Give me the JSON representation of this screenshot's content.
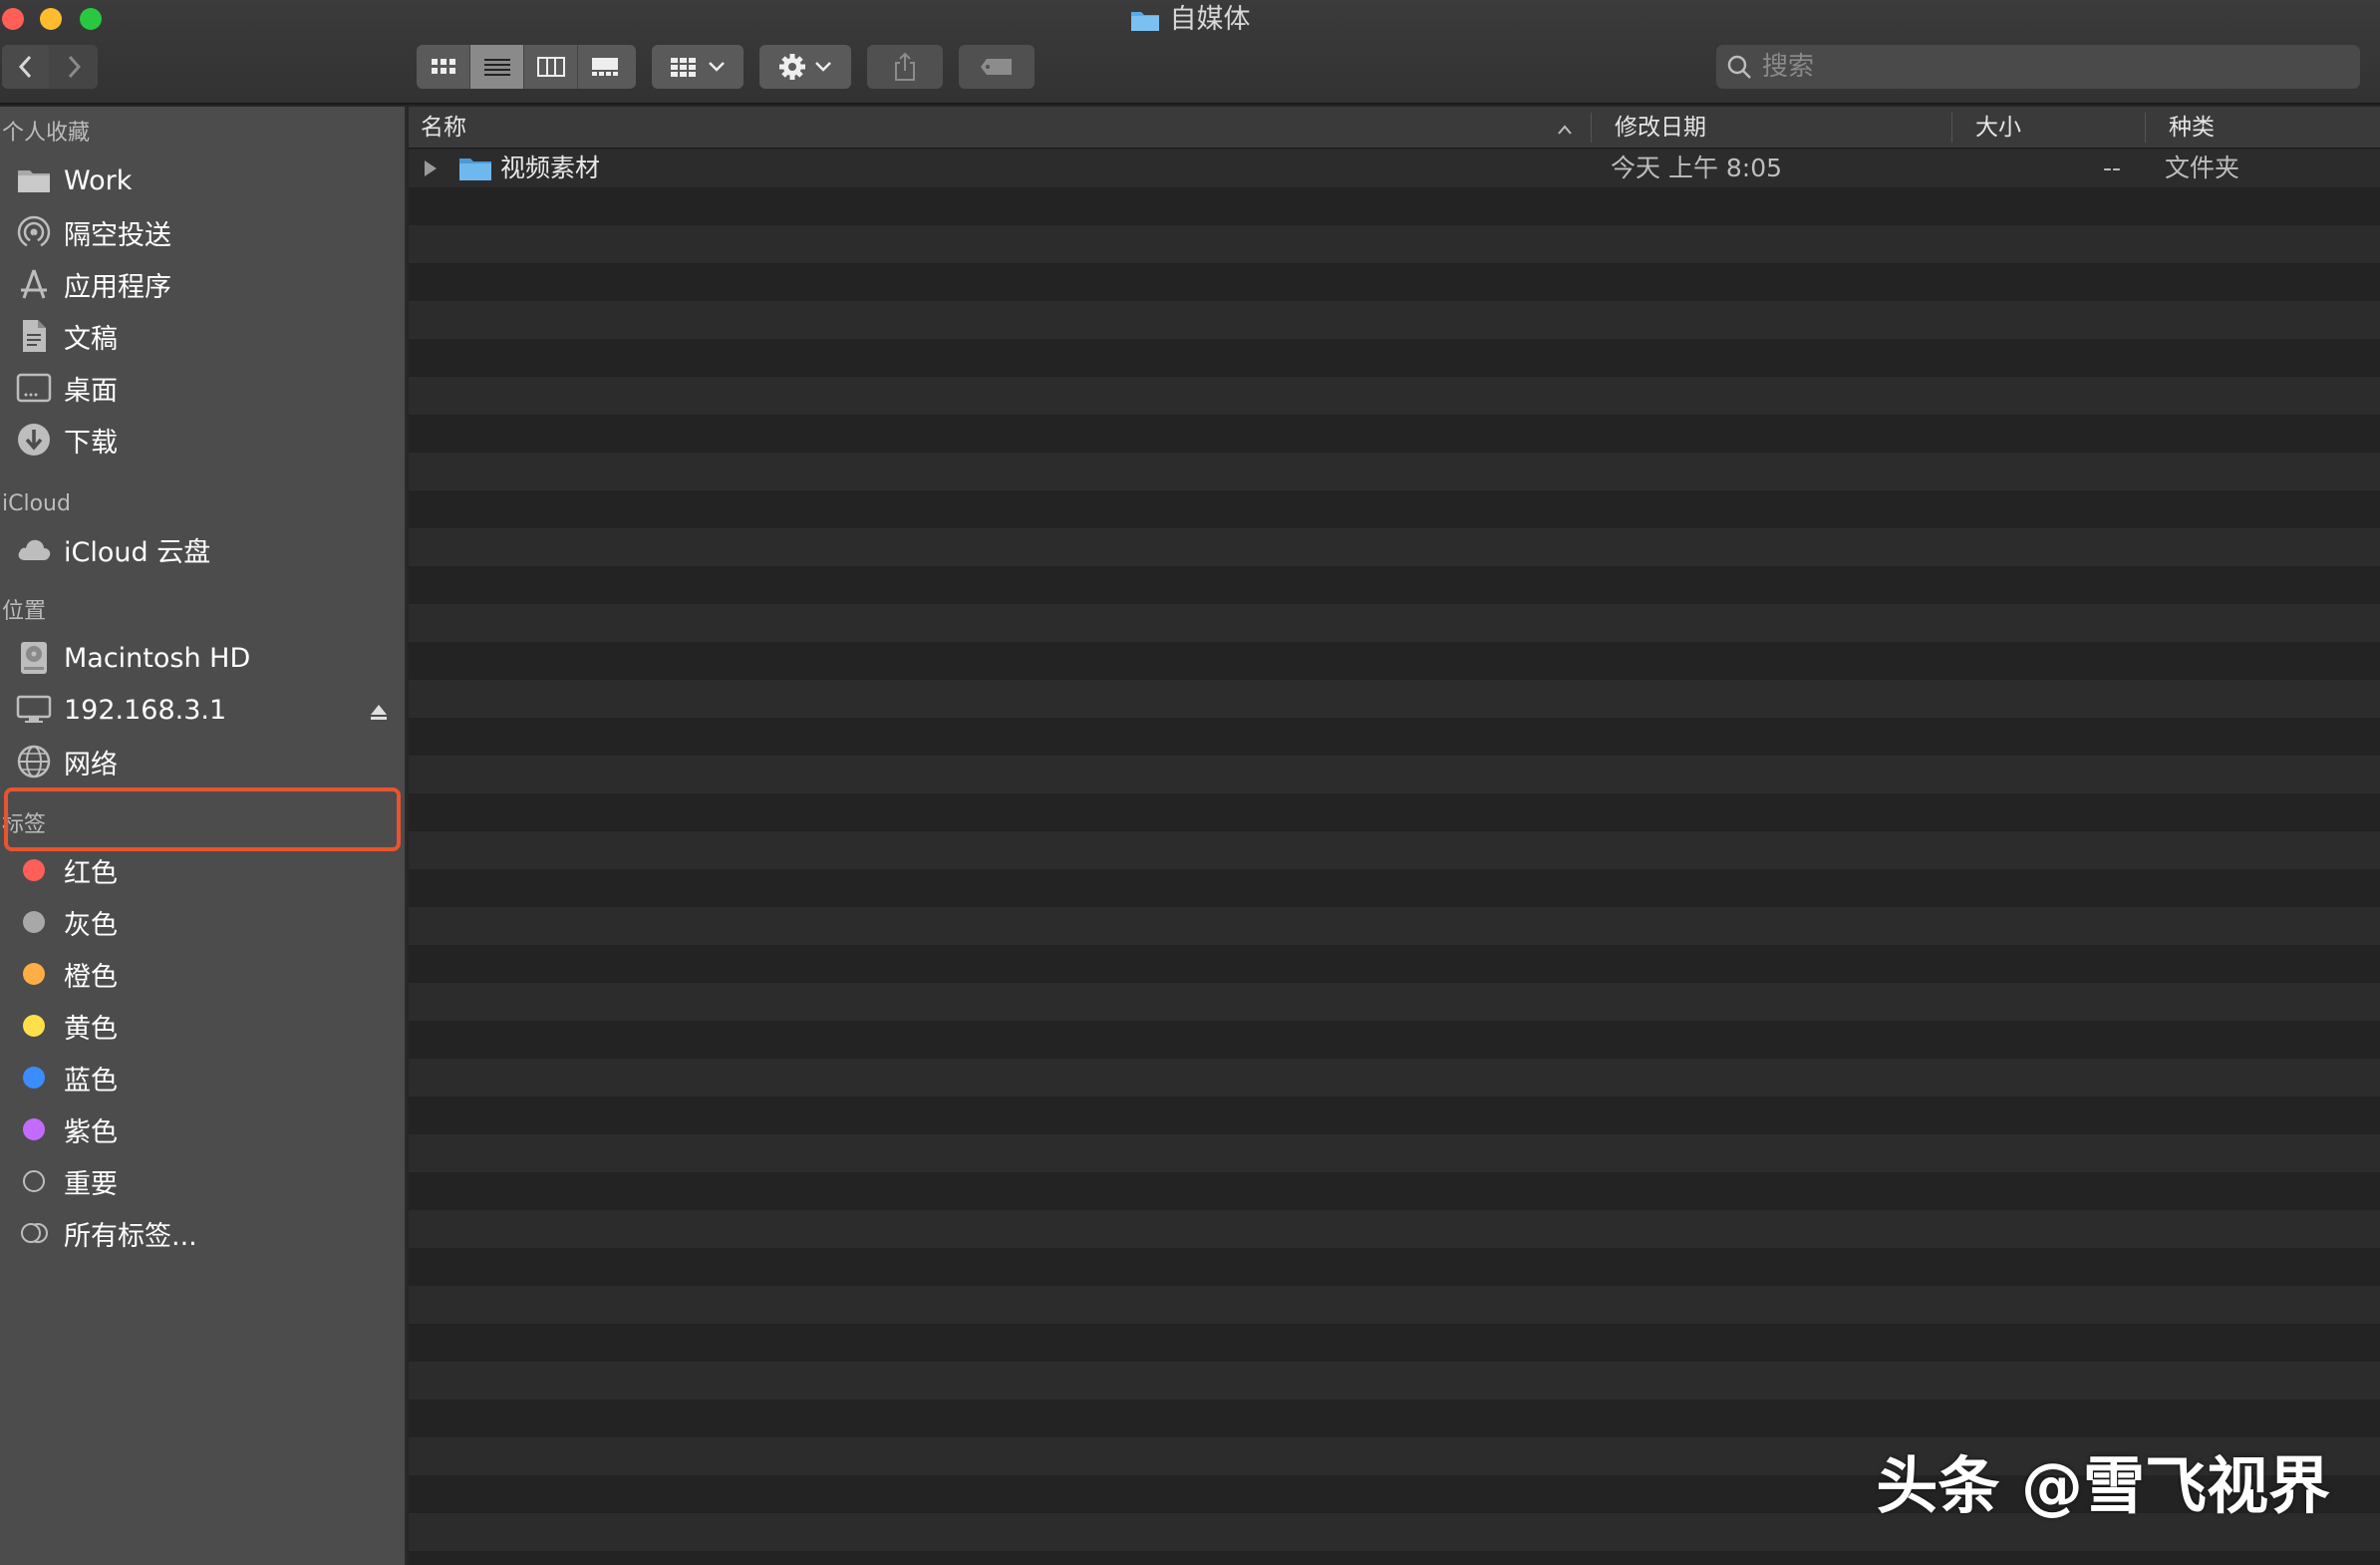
{
  "window": {
    "title": "自媒体"
  },
  "toolbar": {
    "search_placeholder": "搜索"
  },
  "sidebar": {
    "favorites_title": "个人收藏",
    "favorites": [
      {
        "label": "Work",
        "icon": "folder-icon"
      },
      {
        "label": "隔空投送",
        "icon": "airdrop-icon"
      },
      {
        "label": "应用程序",
        "icon": "applications-icon"
      },
      {
        "label": "文稿",
        "icon": "document-icon"
      },
      {
        "label": "桌面",
        "icon": "desktop-icon"
      },
      {
        "label": "下载",
        "icon": "download-icon"
      }
    ],
    "icloud_title": "iCloud",
    "icloud": [
      {
        "label": "iCloud 云盘",
        "icon": "cloud-icon"
      }
    ],
    "locations_title": "位置",
    "locations": [
      {
        "label": "Macintosh HD",
        "icon": "disk-icon"
      },
      {
        "label": "192.168.3.1",
        "icon": "server-icon"
      },
      {
        "label": "网络",
        "icon": "network-icon"
      }
    ],
    "tags_title": "标签",
    "tags": [
      {
        "label": "红色",
        "color": "#ff5f57"
      },
      {
        "label": "灰色",
        "color": "#a8a8a8"
      },
      {
        "label": "橙色",
        "color": "#ffad46"
      },
      {
        "label": "黄色",
        "color": "#ffe04b"
      },
      {
        "label": "蓝色",
        "color": "#3b8cff"
      },
      {
        "label": "紫色",
        "color": "#c46bff"
      },
      {
        "label": "重要",
        "color": ""
      },
      {
        "label": "所有标签...",
        "color": ""
      }
    ]
  },
  "list": {
    "columns": {
      "name": "名称",
      "modified": "修改日期",
      "size": "大小",
      "kind": "种类"
    },
    "rows": [
      {
        "name": "视频素材",
        "modified": "今天 上午 8:05",
        "size": "--",
        "kind": "文件夹"
      }
    ]
  },
  "watermark": "头条 @雪飞视界",
  "colors": {
    "highlight": "#e8542f",
    "folder": "#5aa9e6"
  }
}
